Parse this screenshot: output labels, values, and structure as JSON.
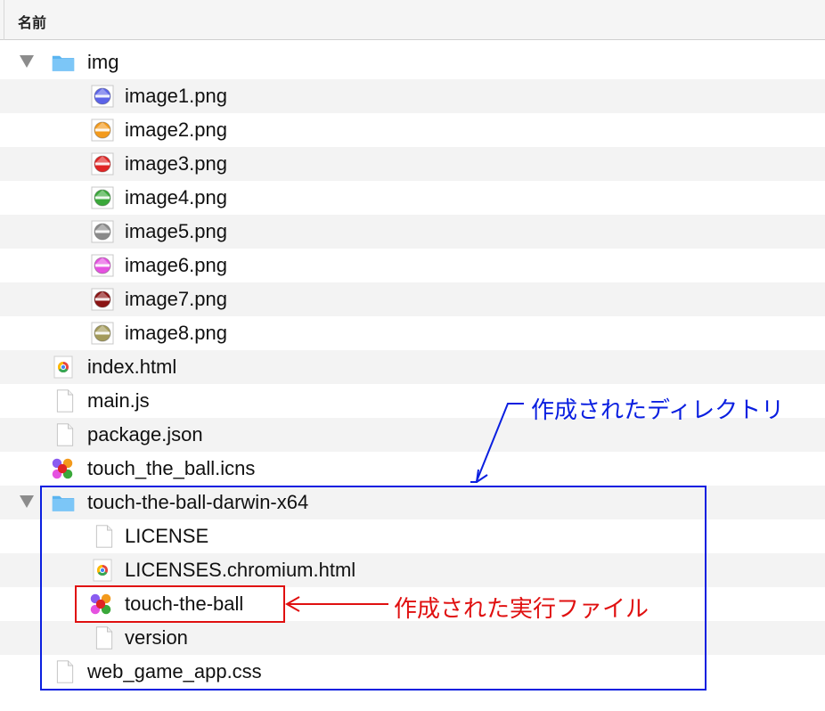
{
  "header": {
    "name_column": "名前"
  },
  "files": [
    {
      "label": "img",
      "icon": "folder-icon"
    },
    {
      "label": "image1.png",
      "icon": "image-icon",
      "color": "#5b63e8"
    },
    {
      "label": "image2.png",
      "icon": "image-icon",
      "color": "#f39a1c"
    },
    {
      "label": "image3.png",
      "icon": "image-icon",
      "color": "#e02424"
    },
    {
      "label": "image4.png",
      "icon": "image-icon",
      "color": "#3aa83a"
    },
    {
      "label": "image5.png",
      "icon": "image-icon",
      "color": "#8a8a8a"
    },
    {
      "label": "image6.png",
      "icon": "image-icon",
      "color": "#e552e0"
    },
    {
      "label": "image7.png",
      "icon": "image-icon",
      "color": "#8b1414"
    },
    {
      "label": "image8.png",
      "icon": "image-icon",
      "color": "#a39a5a"
    },
    {
      "label": "index.html",
      "icon": "chrome-icon"
    },
    {
      "label": "main.js",
      "icon": "document-icon"
    },
    {
      "label": "package.json",
      "icon": "document-icon"
    },
    {
      "label": "touch_the_ball.icns",
      "icon": "app-icon"
    },
    {
      "label": "touch-the-ball-darwin-x64",
      "icon": "folder-icon"
    },
    {
      "label": "LICENSE",
      "icon": "document-icon"
    },
    {
      "label": "LICENSES.chromium.html",
      "icon": "chrome-icon"
    },
    {
      "label": "touch-the-ball",
      "icon": "app-icon"
    },
    {
      "label": "version",
      "icon": "document-icon"
    },
    {
      "label": "web_game_app.css",
      "icon": "document-icon"
    }
  ],
  "annotations": {
    "directory_label": "作成されたディレクトリ",
    "executable_label": "作成された実行ファイル",
    "directory_color": "#0a1fe0",
    "executable_color": "#e01010"
  }
}
